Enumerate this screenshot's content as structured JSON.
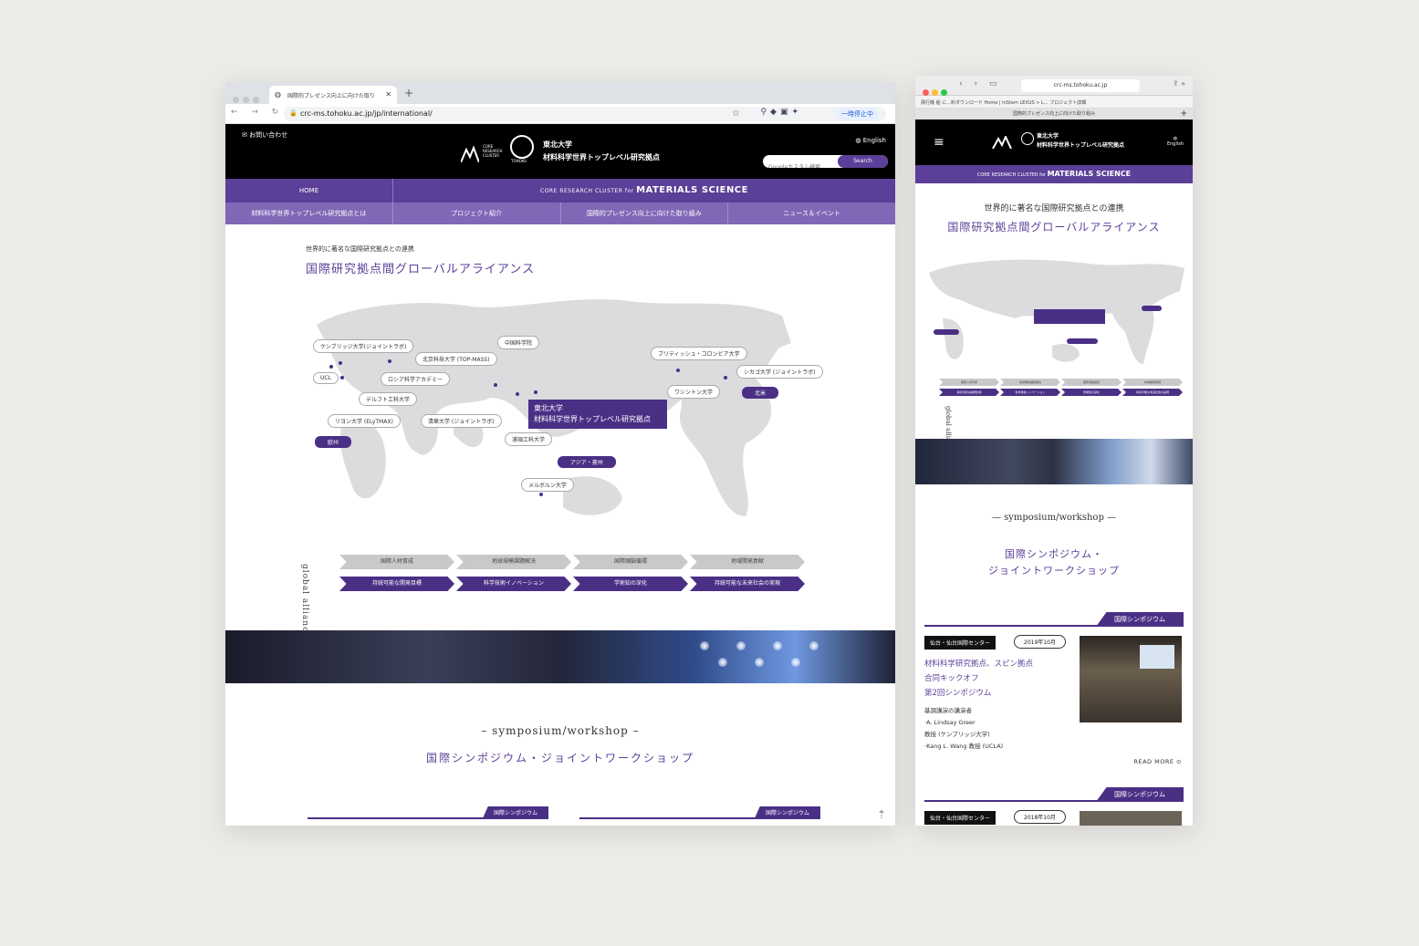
{
  "desktop": {
    "tab_title": "国際的プレゼンス向上に向けた取り",
    "url": "crc-ms.tohoku.ac.jp/jp/international/",
    "pause_label": "一時停止中",
    "header": {
      "contact": "お問い合わせ",
      "crc_logo_text": "CORE RESEARCH CLUSTER",
      "tohoku_logo_text": "TOHOKU",
      "title_line1": "東北大学",
      "title_line2": "材料科学世界トップレベル研究拠点",
      "lang": "English",
      "search_placeholder": "Googleカスタム検索",
      "search_button": "Search"
    },
    "nav": {
      "home": "HOME",
      "brand_prefix": "CORE RESEARCH CLUSTER for ",
      "brand_main": "MATERIALS SCIENCE",
      "items": [
        "材料科学世界トップレベル研究拠点とは",
        "プロジェクト紹介",
        "国際的プレゼンス向上に向けた取り組み",
        "ニュース＆イベント"
      ]
    },
    "section": {
      "subtitle": "世界的に著名な国際研究拠点との連携",
      "title": "国際研究拠点間グローバルアライアンス"
    },
    "map_labels": {
      "cambridge": "ケンブリッジ大学(ジョイントラボ)",
      "ucl": "UCL",
      "russia": "ロシア科学アカデミー",
      "delft": "デルフト工科大学",
      "lyon": "リヨン大学 (ELyTMAX)",
      "europe": "欧州",
      "beijing": "北京科技大学 (TOP-MASS)",
      "cas": "中国科学院",
      "tsinghua": "清華大学 (ジョイントラボ)",
      "pohang": "浦項工科大学",
      "asia": "アジア・豪州",
      "melbourne": "メルボルン大学",
      "ubc": "ブリティッシュ・コロンビア大学",
      "chicago": "シカゴ大学 (ジョイントラボ)",
      "washington": "ワシントン大学",
      "na": "北米",
      "home_line1": "東北大学",
      "home_line2": "材料科学世界トップレベル研究拠点"
    },
    "arrows_top": [
      "国際人材育成",
      "地球規模課題解決",
      "国際頭脳循環",
      "地域開発貢献"
    ],
    "arrows_bottom": [
      "持続可能な開発目標",
      "科学技術イノベーション",
      "学術知の深化",
      "持続可能な未来社会の実現"
    ],
    "global_alliance": "global alliance",
    "symposium_heading": "– symposium/workshop –",
    "symposium_title": "国際シンポジウム・ジョイントワークショップ",
    "card_label": "国際シンポジウム"
  },
  "mobile": {
    "url": "crc-ms.tohoku.ac.jp",
    "bookmarks": "飛行機  船 に...料ダウンロード   Home | InStem   LEXUS > L... プロジェクト詳細",
    "tab_title": "国際的プレゼンス向上に向けた取り組み",
    "header_line1": "東北大学",
    "header_line2": "材料科学世界トップレベル研究拠点",
    "lang": "English",
    "brand_prefix": "CORE RESEARCH CLUSTER for ",
    "brand_main": "MATERIALS SCIENCE",
    "subtitle": "世界的に著名な国際研究拠点との連携",
    "title": "国際研究拠点間グローバルアライアンス",
    "global_alliance": "global alliance",
    "symposium_heading": "— symposium/workshop —",
    "symposium_title_line1": "国際シンポジウム・",
    "symposium_title_line2": "ジョイントワークショップ",
    "card1": {
      "label": "国際シンポジウム",
      "place": "仙台・仙台国際センター",
      "date": "2019年10月",
      "title_line1": "材料科学研究拠点、スピン拠点",
      "title_line2": "合同キックオフ",
      "title_line3": "第2回シンポジウム",
      "desc_line1": "基調講演の講演者",
      "desc_line2": "·A. Lindsay Greer",
      "desc_line3": "教授 (ケンブリッジ大学)",
      "desc_line4": "·Kang L. Wang 教授 (UCLA)",
      "more": "READ MORE"
    },
    "card2": {
      "label": "国際シンポジウム",
      "place": "仙台・仙台国際センター",
      "date": "2018年10月"
    }
  },
  "colors": {
    "brand_purple": "#5b3f98",
    "dark_purple": "#4a2f85",
    "nav_light": "#8167b6"
  }
}
